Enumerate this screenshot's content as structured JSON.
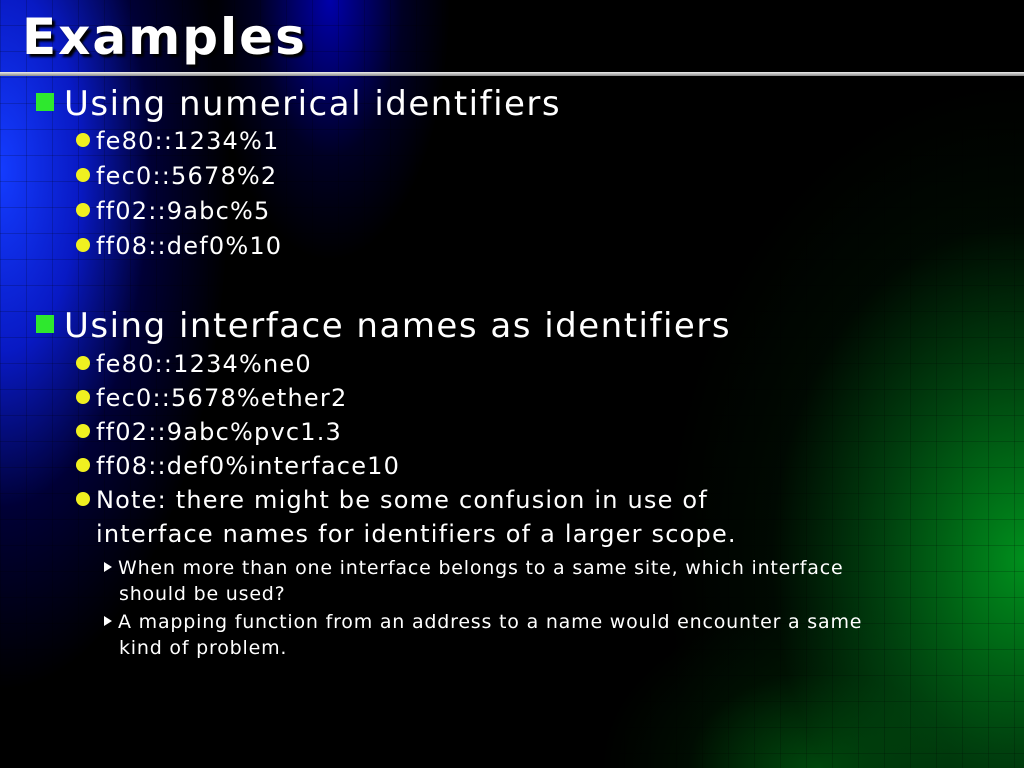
{
  "slide": {
    "title": "Examples",
    "sections": [
      {
        "heading": "Using numerical identifiers",
        "items": [
          "fe80::1234%1",
          "fec0::5678%2",
          "ff02::9abc%5",
          "ff08::def0%10"
        ]
      },
      {
        "heading": "Using interface names as identifiers",
        "items": [
          "fe80::1234%ne0",
          "fec0::5678%ether2",
          "ff02::9abc%pvc1.3",
          "ff08::def0%interface10"
        ],
        "note": {
          "line1": "Note: there might be some confusion in use of",
          "line2": "interface names for identifiers of a larger scope.",
          "sub": [
            {
              "line1": "When more than one interface belongs to a same site, which interface",
              "line2": "should be used?"
            },
            {
              "line1": "A mapping function from an address to a name would encounter a same",
              "line2": "kind of problem."
            }
          ]
        }
      }
    ]
  },
  "colors": {
    "heading_bullet": "#2ee82e",
    "item_bullet": "#f0f020",
    "text": "#ffffff",
    "background": "#000000"
  }
}
